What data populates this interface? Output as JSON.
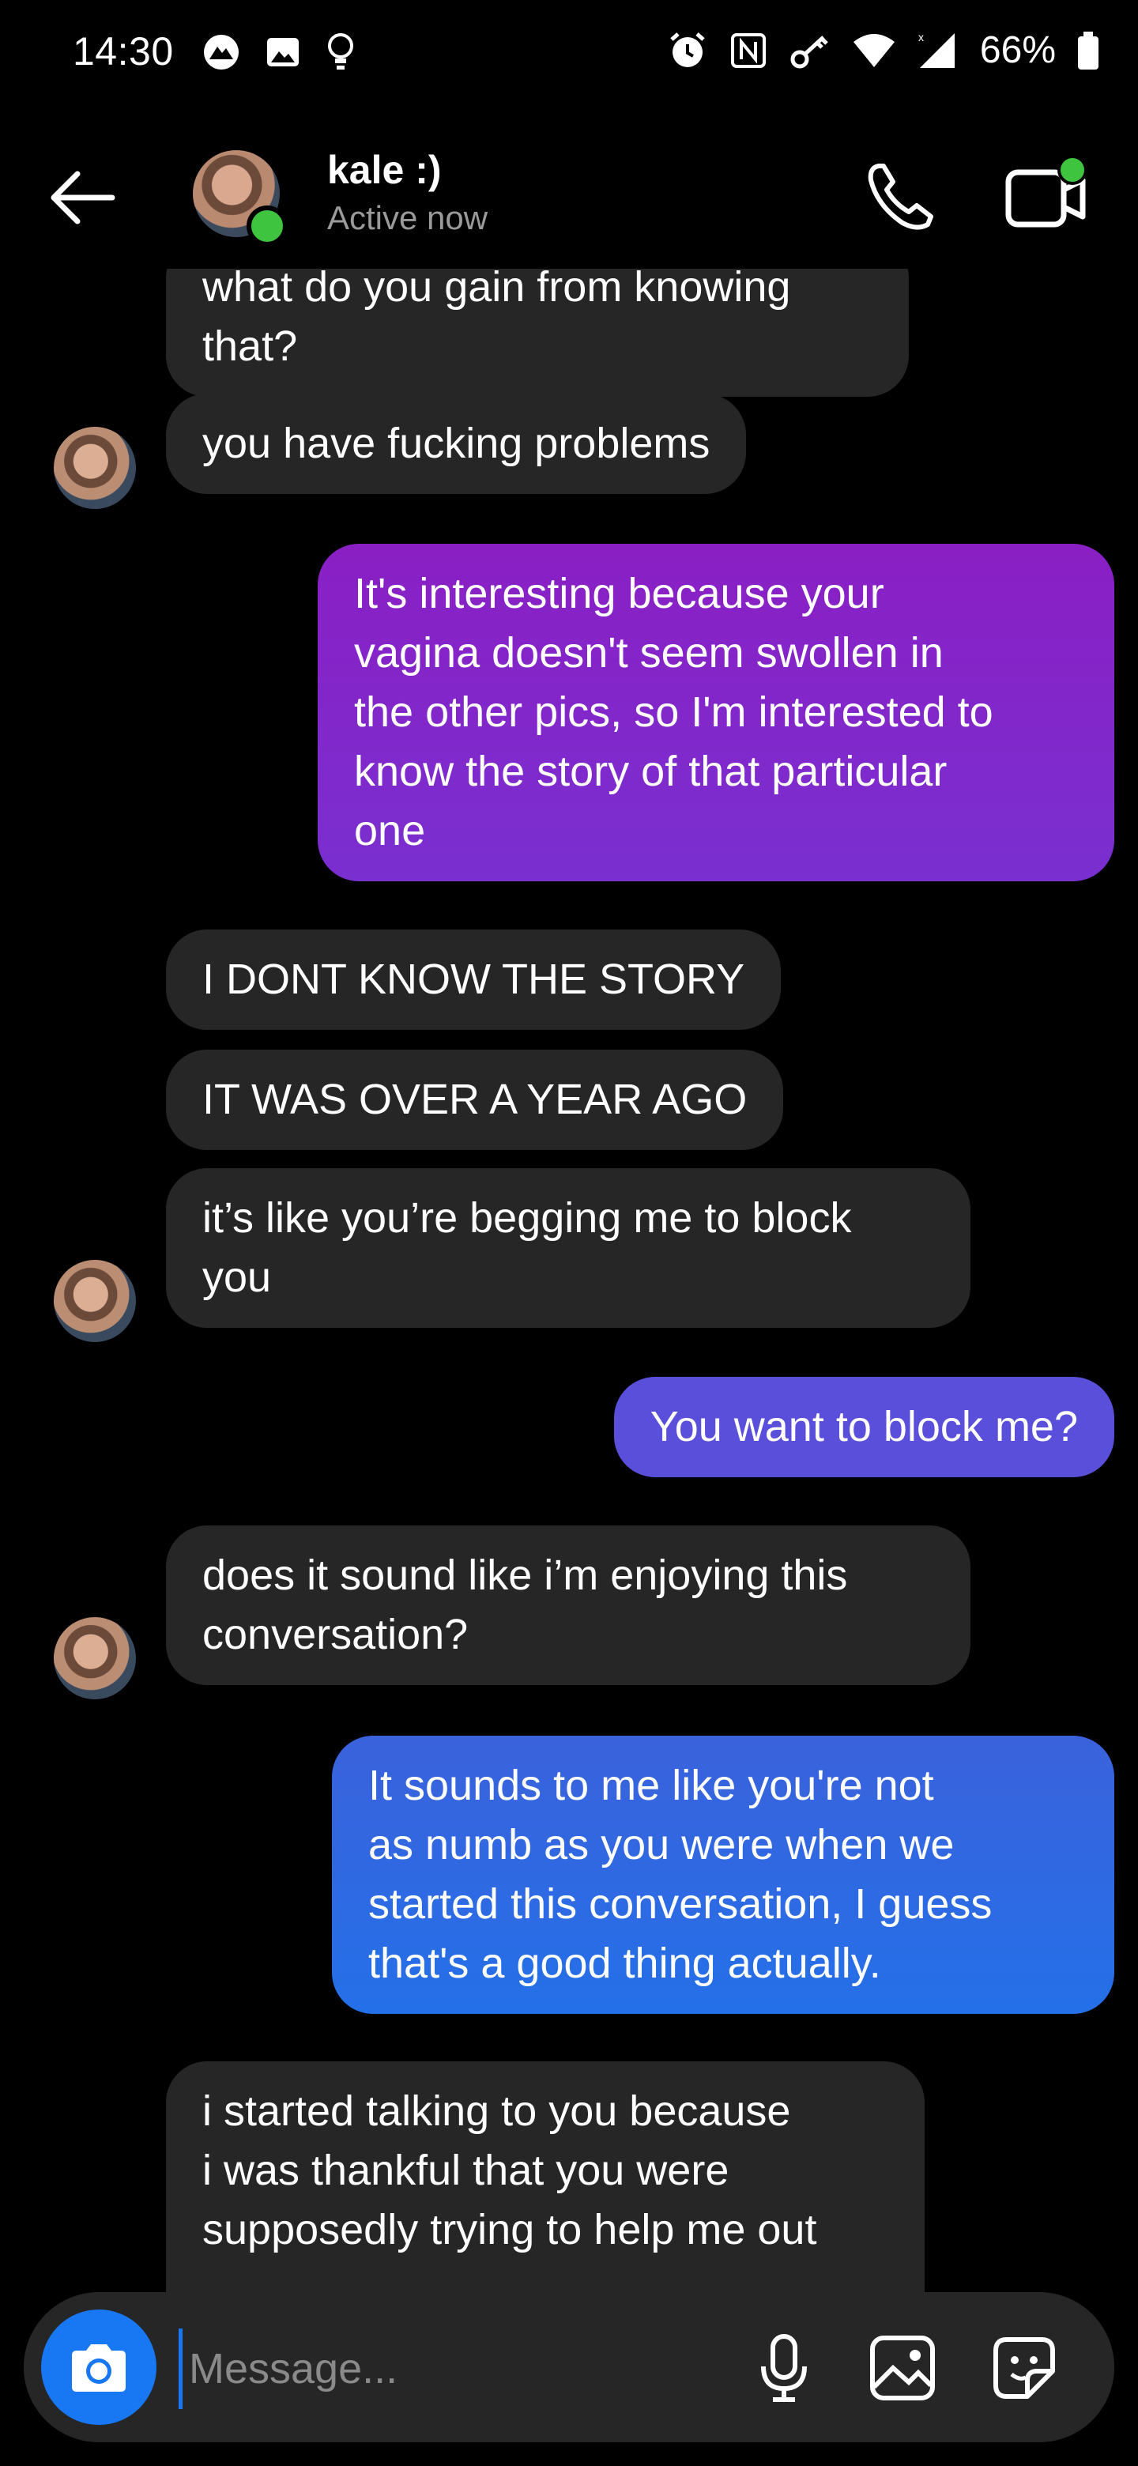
{
  "status_bar": {
    "time": "14:30",
    "battery": "66%"
  },
  "header": {
    "name": "kale :)",
    "status": "Active now"
  },
  "messages": [
    {
      "side": "recv",
      "text": "what do you gain from knowing\nthat?"
    },
    {
      "side": "recv",
      "text": "you have fucking problems"
    },
    {
      "side": "sent",
      "text": "It's interesting because your\nvagina doesn't seem swollen in\nthe other pics, so I'm interested to\nknow the story of that particular\none",
      "color": "#8a22c6"
    },
    {
      "side": "recv",
      "text": "I DONT KNOW THE STORY"
    },
    {
      "side": "recv",
      "text": "IT WAS OVER A YEAR AGO"
    },
    {
      "side": "recv",
      "text": "it’s like you’re begging me to block\nyou"
    },
    {
      "side": "sent",
      "text": "You want to block me?",
      "color": "#5a4fdb"
    },
    {
      "side": "recv",
      "text": "does it sound like i’m enjoying this\nconversation?"
    },
    {
      "side": "sent",
      "text": "It sounds to me like you're not\nas numb as you were when we\nstarted this conversation, I guess\nthat's a good thing actually.",
      "color": "#2f6ee3"
    },
    {
      "side": "recv",
      "text": "i started talking to you because\ni was thankful that you were\nsupposedly trying to help me out"
    }
  ],
  "composer": {
    "placeholder": "Message..."
  },
  "icons": {
    "back": "arrow-left-icon",
    "call": "phone-icon",
    "video": "video-camera-icon",
    "camera": "camera-icon",
    "mic": "microphone-icon",
    "gallery": "image-icon",
    "sticker": "sticker-icon"
  },
  "colors": {
    "received_bubble": "#262626",
    "accent": "#1877f2",
    "online": "#3ec43e"
  }
}
